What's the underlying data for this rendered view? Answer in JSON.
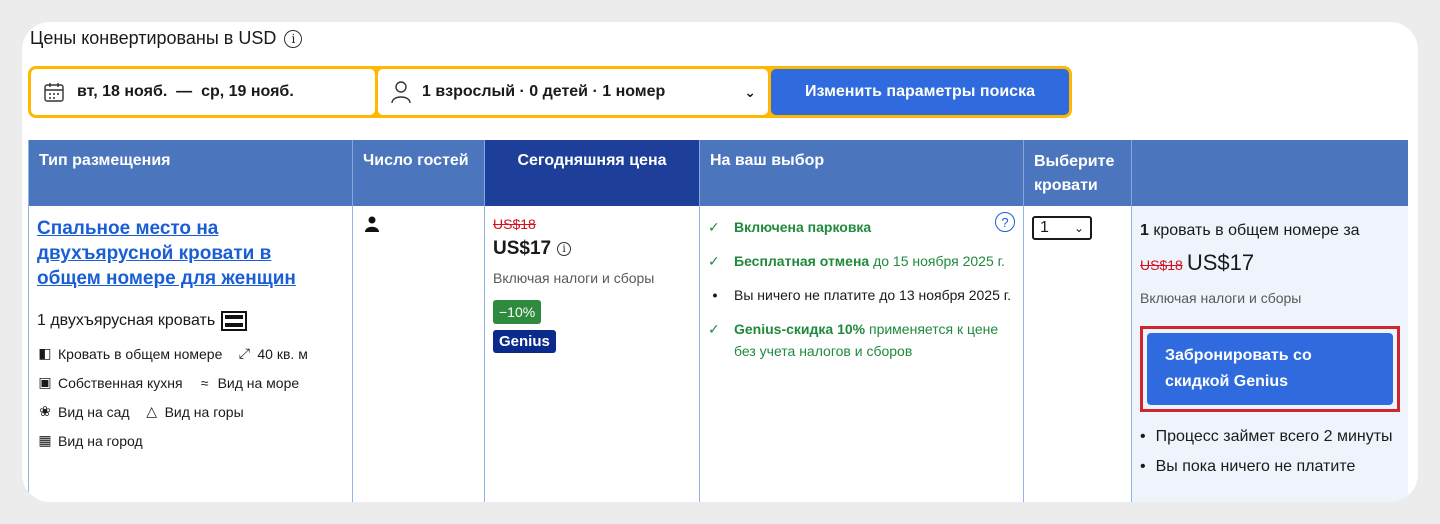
{
  "header": {
    "currency_note": "Цены конвертированы в USD"
  },
  "search": {
    "dates": "вт, 18 нояб.  —  ср, 19 нояб.",
    "guests": "1 взрослый · 0 детей · 1 номер",
    "button": "Изменить параметры поиска"
  },
  "table": {
    "columns": [
      "Тип размещения",
      "Число гостей",
      "Сегодняшняя цена",
      "На ваш выбор",
      "Выберите кровати",
      ""
    ]
  },
  "room": {
    "name": "Спальное место на двухъярусной кровати в общем номере для женщин",
    "bed": "1 двухъярусная кровать",
    "facilities": {
      "shared": "Кровать в общем номере",
      "size": "40 кв. м",
      "kitchen": "Собственная кухня",
      "sea": "Вид на море",
      "garden": "Вид на сад",
      "mountains": "Вид на горы",
      "city": "Вид на город"
    }
  },
  "price": {
    "old": "US$18",
    "new": "US$17",
    "taxes": "Включая налоги и сборы",
    "discount": "−10%",
    "genius": "Genius"
  },
  "choices": {
    "parking": "Включена парковка",
    "cancel_bold": "Бесплатная отмена",
    "cancel_rest": " до 15 ноября 2025 г.",
    "pay_later": "Вы ничего не платите до 13 ноября 2025 г.",
    "genius_bold": "Genius-скидка 10%",
    "genius_rest": " применяется к цене без учета налогов и сборов"
  },
  "select": {
    "value": "1"
  },
  "summary": {
    "count": "1",
    "text": " кровать в общем номере за",
    "old": "US$18",
    "new": "US$17",
    "taxes": "Включая налоги и сборы",
    "book_button": "Забронировать со скидкой Genius",
    "bullets": [
      "Процесс займет всего 2 минуты",
      "Вы пока ничего не платите"
    ]
  }
}
